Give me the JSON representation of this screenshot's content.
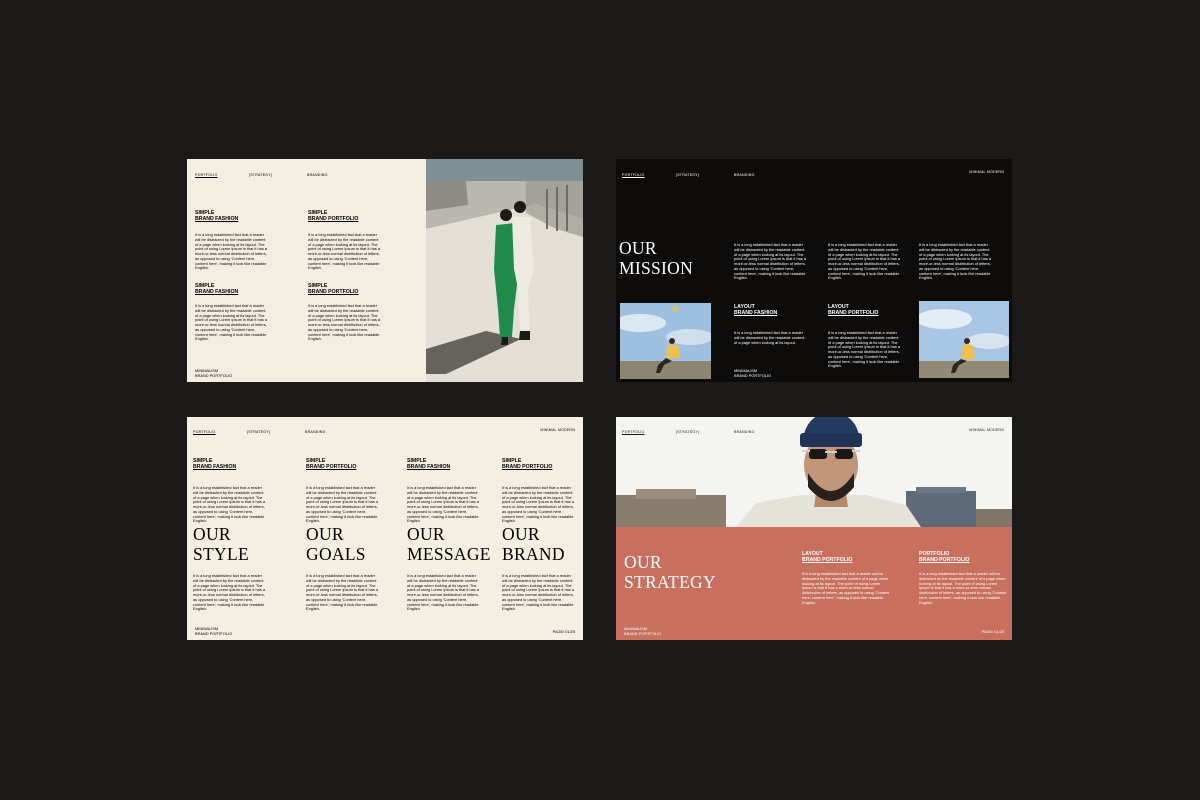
{
  "body_text": "It is a long established fact that a reader will be distracted by the readable content of a page when looking at its layout. The point of using Lorem Ipsum is that it has a more-or-less normal distribution of letters, as opposed to using 'Content here, content here', making it look like readable English.",
  "body_text_short": "It is a long established fact that a reader will be distracted by the readable content of a page when looking at its layout.",
  "slide1": {
    "nav": [
      "PORTFOLIO",
      "[STRATEGY]",
      "BRANDING"
    ],
    "blocks": [
      {
        "l1": "SIMPLE",
        "l2": "BRAND FASHION"
      },
      {
        "l1": "SIMPLE",
        "l2": "BRAND PORTFOLIO"
      },
      {
        "l1": "SIMPLE",
        "l2": "BRAND FASHION"
      },
      {
        "l1": "SIMPLE",
        "l2": "BRAND PORTFOLIO"
      }
    ],
    "footer": [
      "MINIMALISM",
      "BRAND PORTFOLIO"
    ]
  },
  "slide2": {
    "nav": [
      "PORTFOLIO",
      "[STRATEGY]",
      "BRANDING"
    ],
    "tag": "MINIMAL MODERN",
    "title": [
      "OUR",
      "MISSION"
    ],
    "blocks": [
      {
        "l1": "LAYOUT",
        "l2": "BRAND FASHION"
      },
      {
        "l1": "LAYOUT",
        "l2": "BRAND PORTFOLIO"
      }
    ],
    "footer": [
      "MINIMALISM",
      "BRAND PORTFOLIO"
    ]
  },
  "slide3": {
    "nav": [
      "PORTFOLIO",
      "[STRATEGY]",
      "BRANDING"
    ],
    "tag": "MINIMAL MODERN",
    "columns": [
      {
        "l1": "SIMPLE",
        "l2": "BRAND FASHION",
        "title": [
          "OUR",
          "STYLE"
        ]
      },
      {
        "l1": "SIMPLE",
        "l2": "BRAND PORTFOLIO",
        "title": [
          "OUR",
          "GOALS"
        ]
      },
      {
        "l1": "SIMPLE",
        "l2": "BRAND FASHION",
        "title": [
          "OUR",
          "MESSAGE"
        ]
      },
      {
        "l1": "SIMPLE",
        "l2": "BRAND PORTFOLIO",
        "title": [
          "OUR",
          "BRAND"
        ]
      }
    ],
    "footer": [
      "MINIMALISM",
      "BRAND PORTFOLIO"
    ],
    "page": "PAGE/ 01/25"
  },
  "slide4": {
    "nav": [
      "PORTFOLIO",
      "[STRATEGY]",
      "BRANDING"
    ],
    "tag": "MINIMAL MODERN",
    "title": [
      "OUR",
      "STRATEGY"
    ],
    "blocks": [
      {
        "l1": "LAYOUT",
        "l2": "BRAND PORTFOLIO"
      },
      {
        "l1": "PORTFOLIO",
        "l2": "BRAND PORTFOLIO"
      }
    ],
    "footer": [
      "MINIMALISM",
      "BRAND PORTFOLIO"
    ],
    "page": "PAGE/ 01/25"
  },
  "colors": {
    "background": "#1b1a18",
    "cream": "#f3ede2",
    "black_slide": "#0d0c0b",
    "terracotta": "#c86f5d"
  }
}
